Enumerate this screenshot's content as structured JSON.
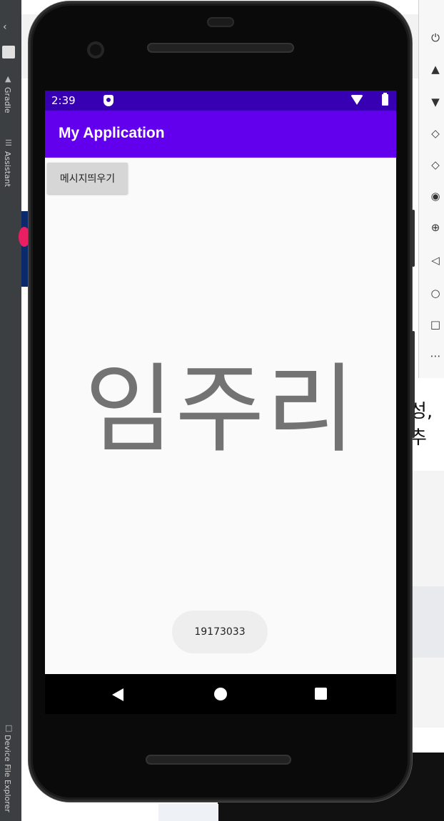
{
  "ide": {
    "left_tabs": [
      "Gradle",
      "Assistant",
      "Device File Explorer"
    ],
    "right_partial_text": "성,추"
  },
  "status_bar": {
    "time": "2:39",
    "icons": [
      "shield-icon",
      "wifi-icon",
      "battery-icon"
    ]
  },
  "app_bar": {
    "title": "My Application"
  },
  "main": {
    "button_label": "메시지띄우기",
    "big_text": "임주리"
  },
  "toast": {
    "text": "19173033"
  },
  "nav_bar": {
    "icons": [
      "back-icon",
      "home-icon",
      "recents-icon"
    ]
  },
  "colors": {
    "status_bar": "#3700b3",
    "app_bar": "#6200ee",
    "screen_bg": "#fafafa",
    "big_text": "#737373",
    "button_bg": "#d6d6d6"
  }
}
